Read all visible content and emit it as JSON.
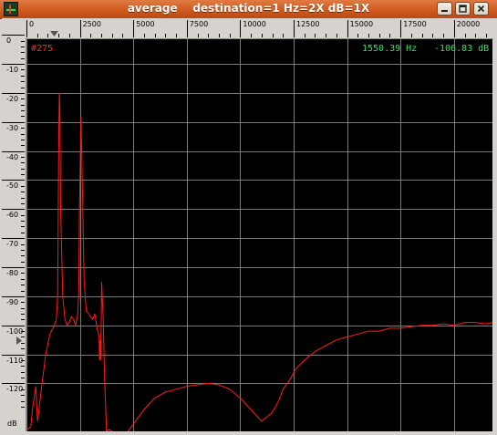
{
  "window": {
    "title": "average    destination=1 Hz=2X dB=1X"
  },
  "freq_axis": {
    "ticks": [
      {
        "value": 0,
        "label": "0"
      },
      {
        "value": 2500,
        "label": "2500"
      },
      {
        "value": 5000,
        "label": "5000"
      },
      {
        "value": 7500,
        "label": "7500"
      },
      {
        "value": 10000,
        "label": "10000"
      },
      {
        "value": 12500,
        "label": "12500"
      },
      {
        "value": 15000,
        "label": "15000"
      },
      {
        "value": 17500,
        "label": "17500"
      },
      {
        "value": 20000,
        "label": "20000"
      }
    ],
    "range": [
      0,
      21800
    ],
    "unit": "Hz"
  },
  "db_axis": {
    "ticks": [
      {
        "value": 0,
        "label": "0"
      },
      {
        "value": -10,
        "label": "-10"
      },
      {
        "value": -20,
        "label": "-20"
      },
      {
        "value": -30,
        "label": "-30"
      },
      {
        "value": -40,
        "label": "-40"
      },
      {
        "value": -50,
        "label": "-50"
      },
      {
        "value": -60,
        "label": "-60"
      },
      {
        "value": -70,
        "label": "-70"
      },
      {
        "value": -80,
        "label": "-80"
      },
      {
        "value": -90,
        "label": "-90"
      },
      {
        "value": -100,
        "label": "-100"
      },
      {
        "value": -110,
        "label": "-110"
      },
      {
        "value": -120,
        "label": "-120"
      }
    ],
    "range": [
      -136.5,
      -1.5
    ],
    "unit_label": "dB"
  },
  "readout": {
    "frame": "#275",
    "freq": "1550.39 Hz",
    "db": "-106.83 dB"
  },
  "markers": {
    "freq_marker_hz": 1300,
    "db_marker_db": -105
  },
  "colors": {
    "plot_bg": "#000000",
    "grid": "#7a7a7a",
    "trace": "#ff1a1a",
    "readout_green": "#38e060",
    "readout_red": "#ff2a2a",
    "titlebar": "#d05a1f"
  },
  "chart_data": {
    "type": "line",
    "series": [
      {
        "x": [
          0,
          200,
          300,
          440,
          480,
          520,
          700,
          900,
          1100,
          1300,
          1400,
          1460,
          1480,
          1500,
          1520,
          1540,
          1560,
          1600,
          1700,
          1800,
          1900,
          2000,
          2100,
          2200,
          2300,
          2400,
          2450,
          2480,
          2520,
          2550,
          2600,
          2700,
          2800,
          2900,
          3000,
          3100,
          3200,
          3300,
          3400,
          3420,
          3450,
          3470,
          3500,
          3520,
          3600,
          3660,
          3700,
          3750,
          3800,
          3900,
          4100,
          4300,
          4500,
          4700,
          5000,
          5500,
          6000,
          6500,
          7000,
          7500,
          8000,
          8500,
          9000,
          9500,
          10000,
          10500,
          11000,
          11500,
          11800,
          12000,
          12300,
          12600,
          13000,
          13500,
          14000,
          14500,
          15000,
          15500,
          16000,
          16500,
          17000,
          17500,
          18000,
          18500,
          19000,
          19500,
          20000,
          20500,
          21000,
          21500,
          21800
        ],
        "y": [
          -136,
          -135,
          -128,
          -121,
          -128,
          -133,
          -122,
          -110,
          -103,
          -100,
          -98,
          -90,
          -70,
          -45,
          -32,
          -20,
          -25,
          -60,
          -90,
          -98,
          -100,
          -99,
          -97,
          -98,
          -100,
          -96,
          -88,
          -62,
          -42,
          -28,
          -45,
          -85,
          -95,
          -96,
          -97,
          -98,
          -96,
          -101,
          -104,
          -112,
          -105,
          -112,
          -98,
          -85,
          -100,
          -120,
          -127,
          -137,
          -136,
          -136,
          -137,
          -137,
          -137,
          -137,
          -134,
          -129,
          -125,
          -123,
          -122,
          -121,
          -120.5,
          -120,
          -120.5,
          -122,
          -125,
          -129,
          -133,
          -130,
          -126,
          -122,
          -119,
          -115,
          -112,
          -109,
          -107,
          -105,
          -104,
          -103,
          -102,
          -102,
          -101,
          -101,
          -100.5,
          -100,
          -100,
          -99.5,
          -100,
          -99,
          -99,
          -99.5,
          -99
        ]
      }
    ],
    "xlim": [
      0,
      21800
    ],
    "ylim": [
      -136.5,
      -1.5
    ],
    "grid": true
  }
}
